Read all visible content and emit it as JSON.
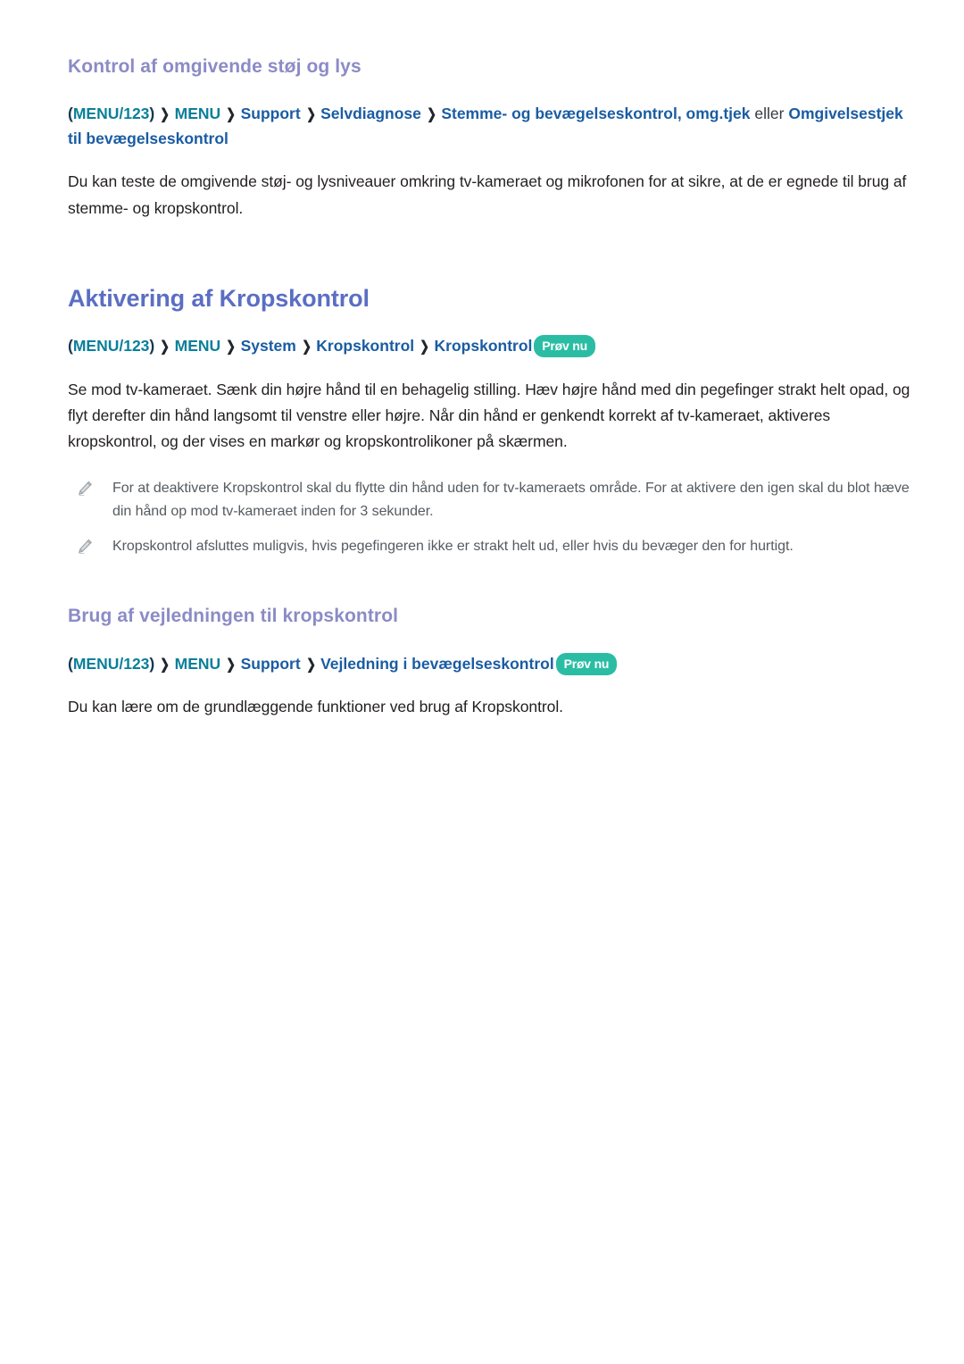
{
  "document": {
    "language": "da",
    "colors": {
      "sub_heading": "#8b8bc6",
      "main_heading": "#5b6ec4",
      "breadcrumb_teal": "#0a7f9a",
      "breadcrumb_blue": "#1a5ca3",
      "try_now_badge": "#2bbda4",
      "body_text": "#231f20",
      "note_text": "#555b60"
    }
  },
  "sections": [
    {
      "id": "ambient-noise-light",
      "heading": "Kontrol af omgivende støj og lys",
      "breadcrumb": {
        "open_paren": "(",
        "menu123": "MENU/123",
        "close_paren": ")",
        "separator": "❯",
        "items": [
          {
            "label": "MENU",
            "style": "teal"
          },
          {
            "label": "Support",
            "style": "blue"
          },
          {
            "label": "Selvdiagnose",
            "style": "blue"
          },
          {
            "label": "Stemme- og bevægelseskontrol, omg.tjek",
            "style": "blue"
          }
        ],
        "conjunction": "eller",
        "trailing": "Omgivelsestjek til bevægelseskontrol",
        "try_now": null
      },
      "paragraph": "Du kan teste de omgivende støj- og lysniveauer omkring tv-kameraet og mikrofonen for at sikre, at de er egnede til brug af stemme- og kropskontrol."
    },
    {
      "id": "activate-body-control",
      "heading": "Aktivering af Kropskontrol",
      "breadcrumb": {
        "open_paren": "(",
        "menu123": "MENU/123",
        "close_paren": ")",
        "separator": "❯",
        "items": [
          {
            "label": "MENU",
            "style": "teal"
          },
          {
            "label": "System",
            "style": "blue"
          },
          {
            "label": "Kropskontrol",
            "style": "blue"
          },
          {
            "label": "Kropskontrol",
            "style": "blue"
          }
        ],
        "try_now": "Prøv nu"
      },
      "paragraph": "Se mod tv-kameraet. Sænk din højre hånd til en behagelig stilling. Hæv højre hånd med din pegefinger strakt helt opad, og flyt derefter din hånd langsomt til venstre eller højre. Når din hånd er genkendt korrekt af tv-kameraet, aktiveres kropskontrol, og der vises en markør og kropskontrolikoner på skærmen.",
      "notes": [
        "For at deaktivere Kropskontrol skal du flytte din hånd uden for tv-kameraets område. For at aktivere den igen skal du blot hæve din hånd op mod tv-kameraet inden for 3 sekunder.",
        "Kropskontrol afsluttes muligvis, hvis pegefingeren ikke er strakt helt ud, eller hvis du bevæger den for hurtigt."
      ]
    },
    {
      "id": "body-control-guide",
      "heading": "Brug af vejledningen til kropskontrol",
      "breadcrumb": {
        "open_paren": "(",
        "menu123": "MENU/123",
        "close_paren": ")",
        "separator": "❯",
        "items": [
          {
            "label": "MENU",
            "style": "teal"
          },
          {
            "label": "Support",
            "style": "blue"
          },
          {
            "label": "Vejledning i bevægelseskontrol",
            "style": "blue"
          }
        ],
        "try_now": "Prøv nu"
      },
      "paragraph": "Du kan lære om de grundlæggende funktioner ved brug af Kropskontrol."
    }
  ],
  "icons": {
    "note_bullet": "pencil-icon"
  }
}
